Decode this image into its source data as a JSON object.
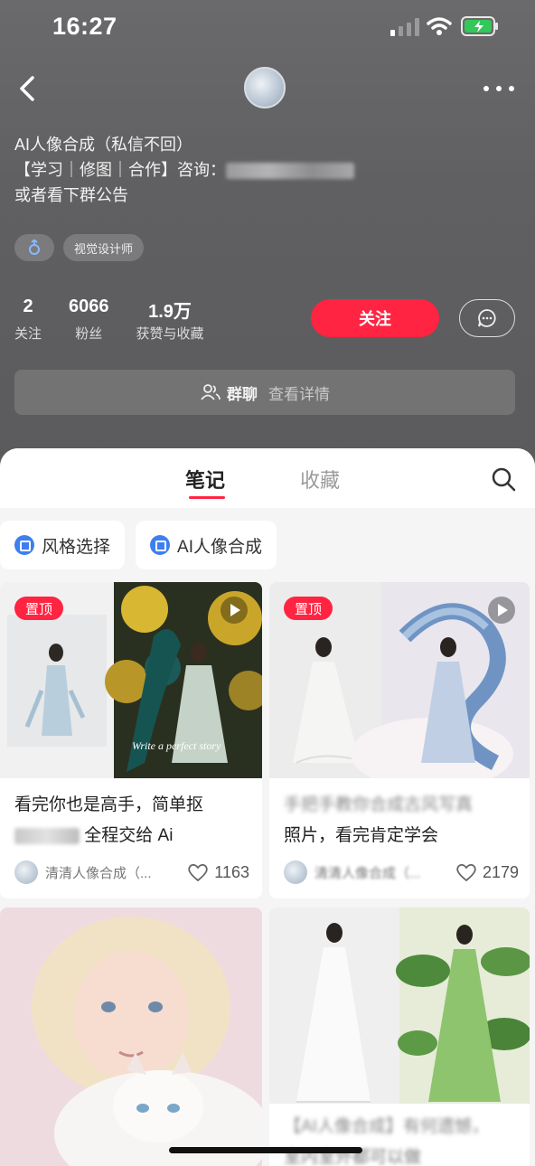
{
  "status_bar": {
    "time": "16:27"
  },
  "profile": {
    "bio_lines": [
      "AI人像合成（私信不回）",
      "【学习｜修图｜合作】咨询：",
      "或者看下群公告"
    ],
    "tags": [
      "视觉设计师"
    ],
    "stats": [
      {
        "value": "2",
        "label": "关注"
      },
      {
        "value": "6066",
        "label": "粉丝"
      },
      {
        "value": "1.9万",
        "label": "获赞与收藏"
      }
    ],
    "follow_label": "关注",
    "group": {
      "label": "群聊",
      "detail": "查看详情"
    }
  },
  "tabs": [
    {
      "label": "笔记",
      "active": true
    },
    {
      "label": "收藏",
      "active": false
    }
  ],
  "chips": [
    "风格选择",
    "AI人像合成"
  ],
  "notes": [
    {
      "pinned": "置顶",
      "title_line1": "看完你也是高手，简单抠",
      "title_line2_end": "全程交给 Ai",
      "author": "清清人像合成（...",
      "likes": "1163"
    },
    {
      "pinned": "置顶",
      "title_line1": "手把手教你合成古风写真",
      "title_line2": "照片，看完肯定学会",
      "author": "清清人像合成（...",
      "likes": "2179"
    },
    {
      "title_line1": "",
      "author": "",
      "likes": ""
    },
    {
      "title_line1": "【AI人像合成】有何遗憾，",
      "title_line2": "室内室外都可以做",
      "author": "",
      "likes": ""
    }
  ]
}
